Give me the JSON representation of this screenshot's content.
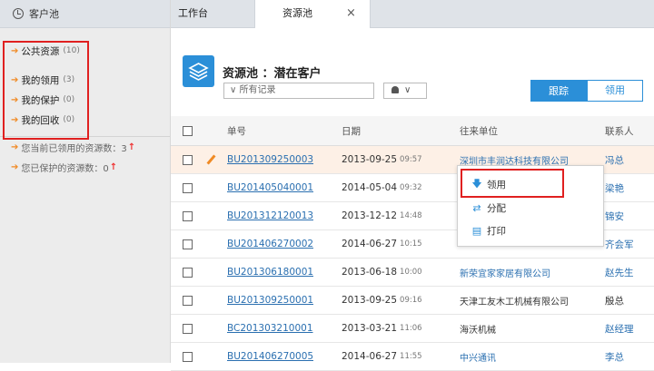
{
  "sidebar": {
    "title": "客户池",
    "items": [
      {
        "label": "公共资源",
        "count": "(10)"
      },
      {
        "label": "我的领用",
        "count": "(3)"
      },
      {
        "label": "我的保护",
        "count": "(0)"
      },
      {
        "label": "我的回收",
        "count": "(0)"
      }
    ],
    "stats": [
      {
        "label": "您当前已领用的资源数：3"
      },
      {
        "label": "您已保护的资源数：0"
      }
    ]
  },
  "tabs": [
    {
      "label": "工作台"
    },
    {
      "label": "资源池"
    }
  ],
  "tab_close": "×",
  "header": {
    "pool_title": "资源池 ：潜在客户",
    "filter_value": "∨ 所有记录",
    "user_filter": "∨",
    "btn_track": "跟踪",
    "btn_claim": "领用"
  },
  "table": {
    "columns": [
      "单号",
      "日期",
      "往来单位",
      "联系人"
    ],
    "rows": [
      {
        "id": "BU201309250003",
        "date": "2013-09-25",
        "time": "09:57",
        "company": "深圳市丰润达科技有限公司",
        "contact": "冯总",
        "selected": true
      },
      {
        "id": "BU201405040001",
        "date": "2014-05-04",
        "time": "09:32",
        "company": "",
        "contact": "梁艳"
      },
      {
        "id": "BU201312120013",
        "date": "2013-12-12",
        "time": "14:48",
        "company": "",
        "contact": "锦安"
      },
      {
        "id": "BU201406270002",
        "date": "2014-06-27",
        "time": "10:15",
        "company": "",
        "contact": "齐会军"
      },
      {
        "id": "BU201306180001",
        "date": "2013-06-18",
        "time": "10:00",
        "company": "新荣宜家家居有限公司",
        "contact": "赵先生"
      },
      {
        "id": "BU201309250001",
        "date": "2013-09-25",
        "time": "09:16",
        "company": "天津工友木工机械有限公司",
        "contact": "殷总"
      },
      {
        "id": "BC201303210001",
        "date": "2013-03-21",
        "time": "11:06",
        "company": "海沃机械",
        "contact": "赵经理"
      },
      {
        "id": "BU201406270005",
        "date": "2014-06-27",
        "time": "11:55",
        "company": "中兴通讯",
        "contact": "李总"
      }
    ]
  },
  "context_menu": {
    "items": [
      {
        "label": "领用",
        "icon": "arrow-down-icon"
      },
      {
        "label": "分配",
        "icon": "share-icon"
      },
      {
        "label": "打印",
        "icon": "print-icon"
      }
    ]
  },
  "colors": {
    "accent": "#2b8fd8",
    "highlight": "#e02020",
    "link": "#2a6fb0",
    "selected_row": "#fdf0e6"
  }
}
